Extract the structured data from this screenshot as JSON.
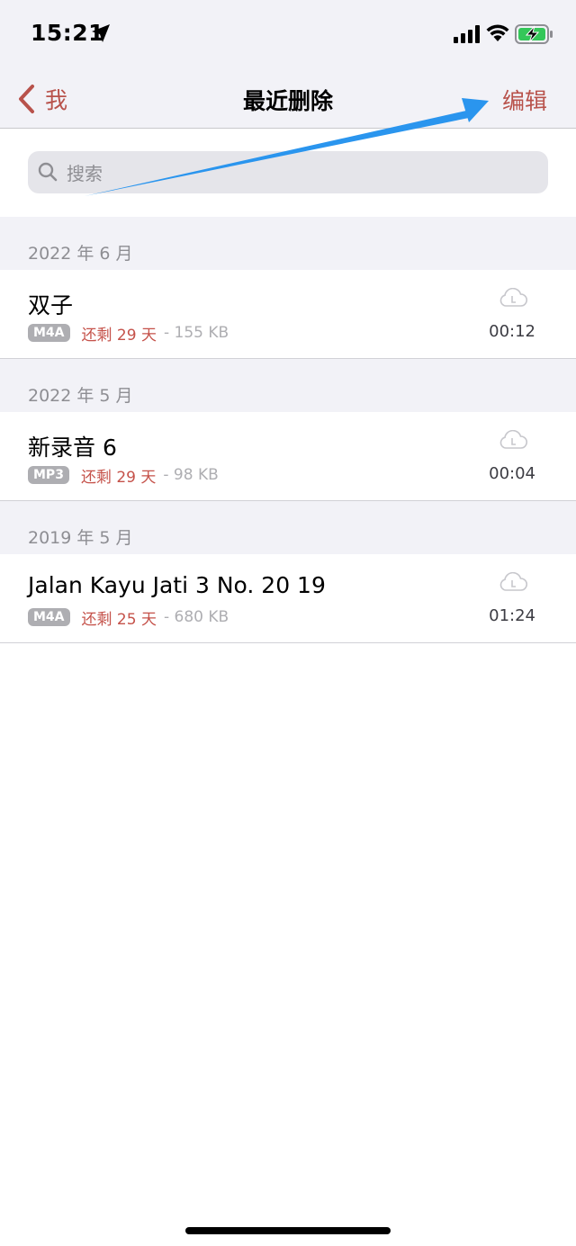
{
  "status_bar": {
    "time": "15:21"
  },
  "nav": {
    "back_label": "我",
    "title": "最近删除",
    "edit_label": "编辑",
    "accent_color": "#b8524b"
  },
  "search": {
    "placeholder": "搜索"
  },
  "sections": [
    {
      "header": "2022 年 6 月",
      "recordings": [
        {
          "title": "双子",
          "format": "M4A",
          "days_left": "还剩 29 天",
          "size": "- 155 KB",
          "duration": "00:12"
        }
      ]
    },
    {
      "header": "2022 年 5 月",
      "recordings": [
        {
          "title": "新录音 6",
          "format": "MP3",
          "days_left": "还剩 29 天",
          "size": "- 98 KB",
          "duration": "00:04"
        }
      ]
    },
    {
      "header": "2019 年 5 月",
      "recordings": [
        {
          "title": "Jalan Kayu Jati 3 No. 20 19",
          "format": "M4A",
          "days_left": "还剩 25 天",
          "size": "- 680 KB",
          "duration": "01:24"
        }
      ]
    }
  ],
  "icons": {
    "back": "chevron-left-icon",
    "search": "search-icon",
    "cloud": "cloud-icon",
    "location": "location-arrow-icon",
    "signal": "cellular-signal-icon",
    "wifi": "wifi-icon",
    "battery": "battery-charging-icon"
  }
}
